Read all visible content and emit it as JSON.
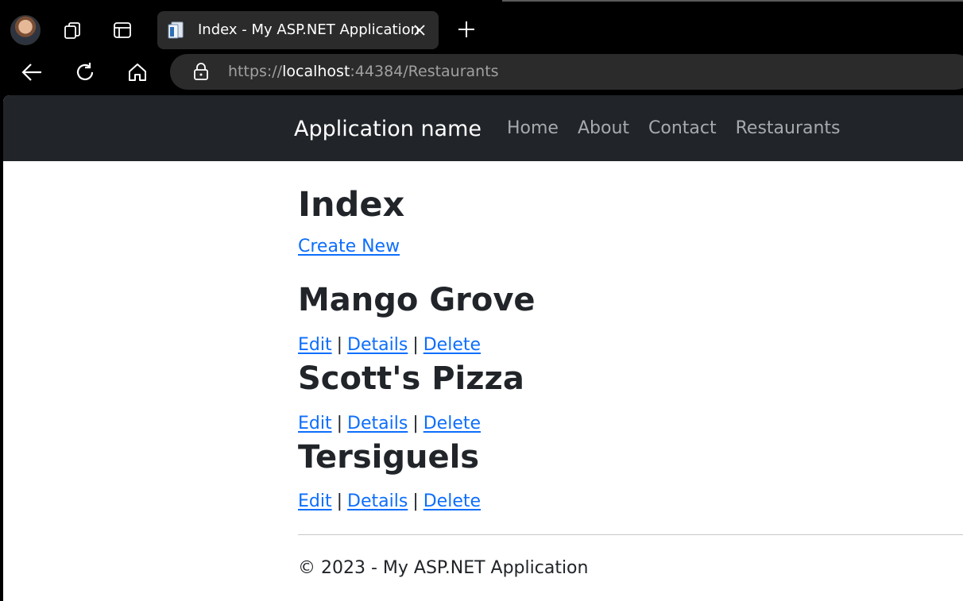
{
  "browser": {
    "tab_title": "Index - My ASP.NET Application",
    "url_scheme": "https://",
    "url_host": "localhost",
    "url_rest": ":44384/Restaurants",
    "icons": [
      "avatar",
      "workspaces-icon",
      "tab-actions-icon",
      "page-icon",
      "close-icon",
      "new-tab-icon",
      "back-icon",
      "refresh-icon",
      "home-icon",
      "lock-icon"
    ]
  },
  "navbar": {
    "brand": "Application name",
    "links": [
      "Home",
      "About",
      "Contact",
      "Restaurants"
    ]
  },
  "main": {
    "heading": "Index",
    "create_link": "Create New",
    "restaurants": [
      {
        "name": "Mango Grove",
        "edit": "Edit",
        "details": "Details",
        "delete": "Delete",
        "separator": "|"
      },
      {
        "name": "Scott's Pizza",
        "edit": "Edit",
        "details": "Details",
        "delete": "Delete",
        "separator": "|"
      },
      {
        "name": "Tersiguels",
        "edit": "Edit",
        "details": "Details",
        "delete": "Delete",
        "separator": "|"
      }
    ]
  },
  "footer": {
    "text": "© 2023 - My ASP.NET Application"
  },
  "colors": {
    "navbar_bg": "#212529",
    "link": "#0d6efd",
    "text": "#212529",
    "chrome_bg": "#000000",
    "tab_bg": "#2b2b2b"
  }
}
